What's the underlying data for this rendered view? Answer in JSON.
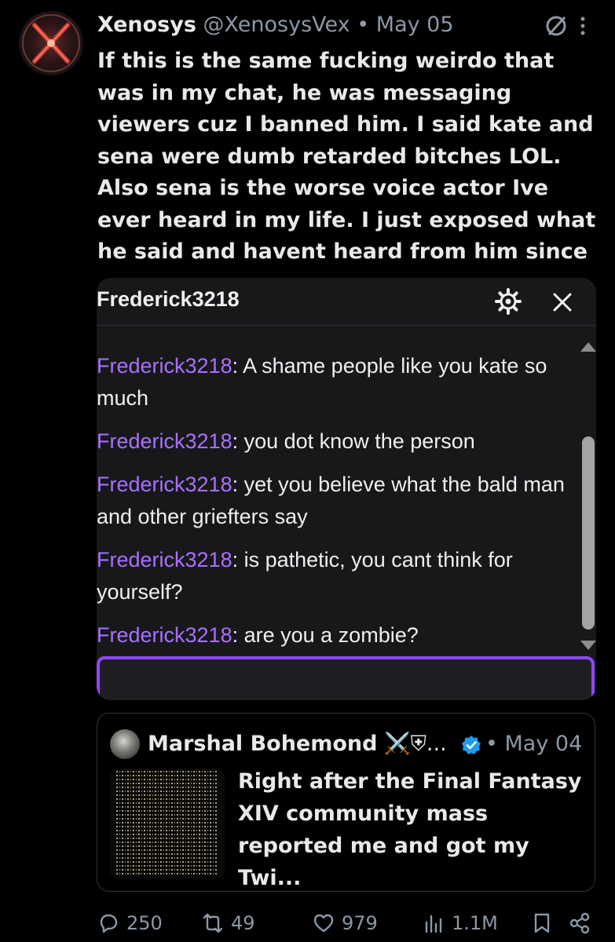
{
  "tweet": {
    "author_name": "Xenosys",
    "author_handle": "@XenosysVex",
    "separator": "•",
    "date": "May 05",
    "text": "If this is the same fucking weirdo that was in my chat, he was messaging viewers cuz I banned him. I said kate and sena were dumb retarded bitches LOL. Also sena is the worse voice actor Ive ever heard in my life. I just exposed what he said and havent heard from him since",
    "avatar_icon": "x-logo-avatar",
    "menu_icon": "more-vertical-icon",
    "grok_icon": "grok-icon"
  },
  "chat": {
    "title": "Frederick3218",
    "accent_color": "#a970ff",
    "input_border_color": "#9147ff",
    "messages": [
      {
        "user": "Frederick3218",
        "sep": ":",
        "text": " A shame people like you kate so much"
      },
      {
        "user": "Frederick3218",
        "sep": ":",
        "text": " you dot know the person"
      },
      {
        "user": "Frederick3218",
        "sep": ":",
        "text": " yet you believe what the bald man and other griefters say"
      },
      {
        "user": "Frederick3218",
        "sep": ":",
        "text": " is pathetic, you cant think for yourself?"
      },
      {
        "user": "Frederick3218",
        "sep": ":",
        "text": " are you a zombie?"
      }
    ]
  },
  "quote": {
    "author_name": "Marshal Bohemond",
    "name_emoji": "⚔️⛨...",
    "date": "• May 04",
    "text": "Right after the Final Fantasy XIV community mass reported me and got my Twi...",
    "verified_color": "#1d9bf0"
  },
  "actions": {
    "replies": "250",
    "reposts": "49",
    "likes": "979",
    "views": "1.1M"
  }
}
